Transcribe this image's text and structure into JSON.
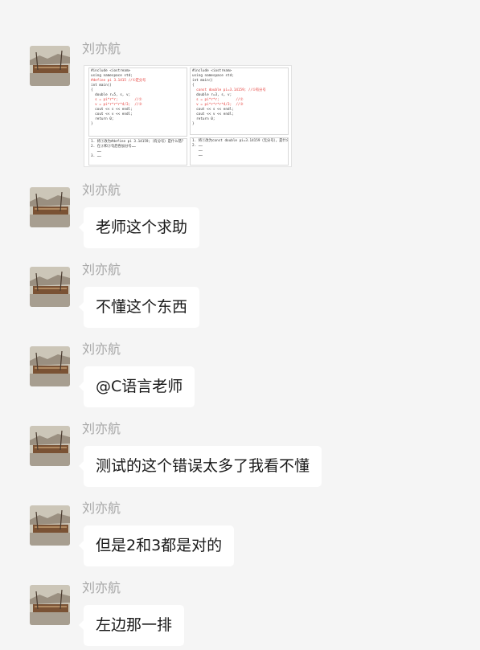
{
  "chat": {
    "messages": [
      {
        "sender": "刘亦航",
        "type": "image",
        "image": {
          "left_code": [
            "#include <iostream>",
            "using namespace std;",
            "#define pi 3.1415 //①定分号",
            "int main()",
            "{",
            "  double r=5, s, v;",
            "  s = pi*r*r;        //②",
            "  v = pi*r*r*r*4/3;  //③",
            "  cout << s << endl;",
            "  cout << v << endl;",
            "  return 0;",
            "}"
          ],
          "left_notes": [
            "1. 将①改为#define pi 3.14159;（有分号）是什么错？",
            "2. 在②和③句后各加分号……",
            "   ……",
            "3. ……"
          ],
          "right_code": [
            "#include <iostream>",
            "using namespace std;",
            "int main()",
            "{",
            "  const double pi=3.14159; //①有分号",
            "  double r=3, s, v;",
            "  s = pi*r*r;        //②",
            "  v = pi*r*r*r*4/3;  //③",
            "  cout << s << endl;",
            "  cout << v << endl;",
            "  return 0;",
            "}"
          ],
          "right_notes": [
            "1. 将①改为const double pi=3.14159（无分号），是什么错？",
            "2. ……",
            "   ……",
            "   ……"
          ]
        }
      },
      {
        "sender": "刘亦航",
        "type": "text",
        "text": "老师这个求助"
      },
      {
        "sender": "刘亦航",
        "type": "text",
        "text": "不懂这个东西"
      },
      {
        "sender": "刘亦航",
        "type": "text",
        "text": "@C语言老师"
      },
      {
        "sender": "刘亦航",
        "type": "text",
        "text": "测试的这个错误太多了我看不懂"
      },
      {
        "sender": "刘亦航",
        "type": "text",
        "text": "但是2和3都是对的"
      },
      {
        "sender": "刘亦航",
        "type": "text",
        "text": "左边那一排"
      }
    ]
  },
  "colors": {
    "background": "#f5f5f5",
    "bubble": "#ffffff",
    "sender_name": "#a8a8a8",
    "message_text": "#191919",
    "code_highlight": "#e53935"
  },
  "icons": {
    "avatar": "avatar-image"
  }
}
